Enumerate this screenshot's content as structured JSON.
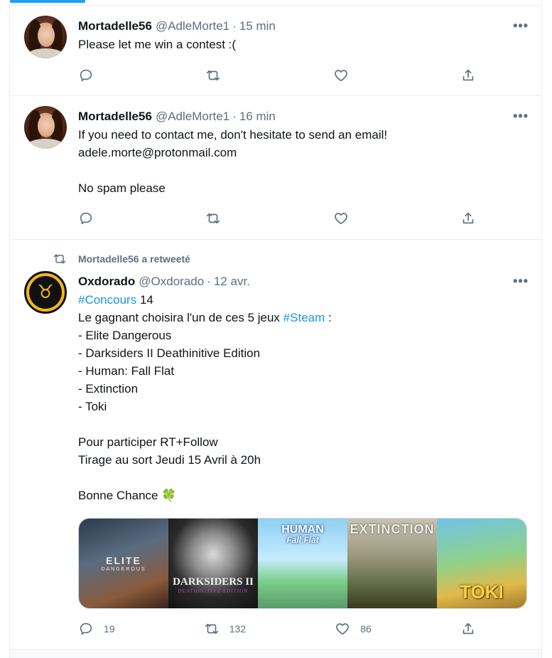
{
  "tweets": [
    {
      "name": "Mortadelle56",
      "handle": "@AdleMorte1",
      "sep": "·",
      "time": "15 min",
      "text": "Please let me win a contest :("
    },
    {
      "name": "Mortadelle56",
      "handle": "@AdleMorte1",
      "sep": "·",
      "time": "16 min",
      "text": "If you need to contact me, don't hesitate to send an email!\nadele.morte@protonmail.com\n\nNo spam please"
    },
    {
      "retweet_label": "Mortadelle56 a retweeté",
      "name": "Oxdorado",
      "handle": "@Oxdorado",
      "sep": "·",
      "time": "12 avr.",
      "hashtag1": "#Concours",
      "text1_after": " 14",
      "text2_before": "Le gagnant choisira l'un de ces 5 jeux ",
      "hashtag2": "#Steam",
      "text2_after": " :",
      "text3": "- Elite Dangerous\n- Darksiders II Deathinitive Edition\n- Human: Fall Flat\n- Extinction\n- Toki\n\nPour participer RT+Follow\nTirage au sort Jeudi 15 Avril à 20h\n\nBonne Chance ",
      "emoji": "🍀",
      "media": {
        "elite": {
          "title": "ELITE",
          "subtitle": "DANGEROUS"
        },
        "darksiders": {
          "title": "DARKSIDERS II",
          "subtitle": "DEATHINITIVE EDITION"
        },
        "human": {
          "title": "HUMAN",
          "subtitle": "Fall Flat"
        },
        "extinction": {
          "title": "EXTINCTION"
        },
        "toki": {
          "title": "TOKI"
        }
      },
      "counts": {
        "replies": "19",
        "retweets": "132",
        "likes": "86"
      }
    }
  ],
  "icons": {
    "more": "more-icon",
    "reply": "reply-icon",
    "retweet": "retweet-icon",
    "like": "heart-icon",
    "share": "share-icon"
  },
  "colors": {
    "accent": "#1da1f2",
    "link": "#1b95e0",
    "muted": "#5b7083",
    "text": "#0f1419"
  }
}
